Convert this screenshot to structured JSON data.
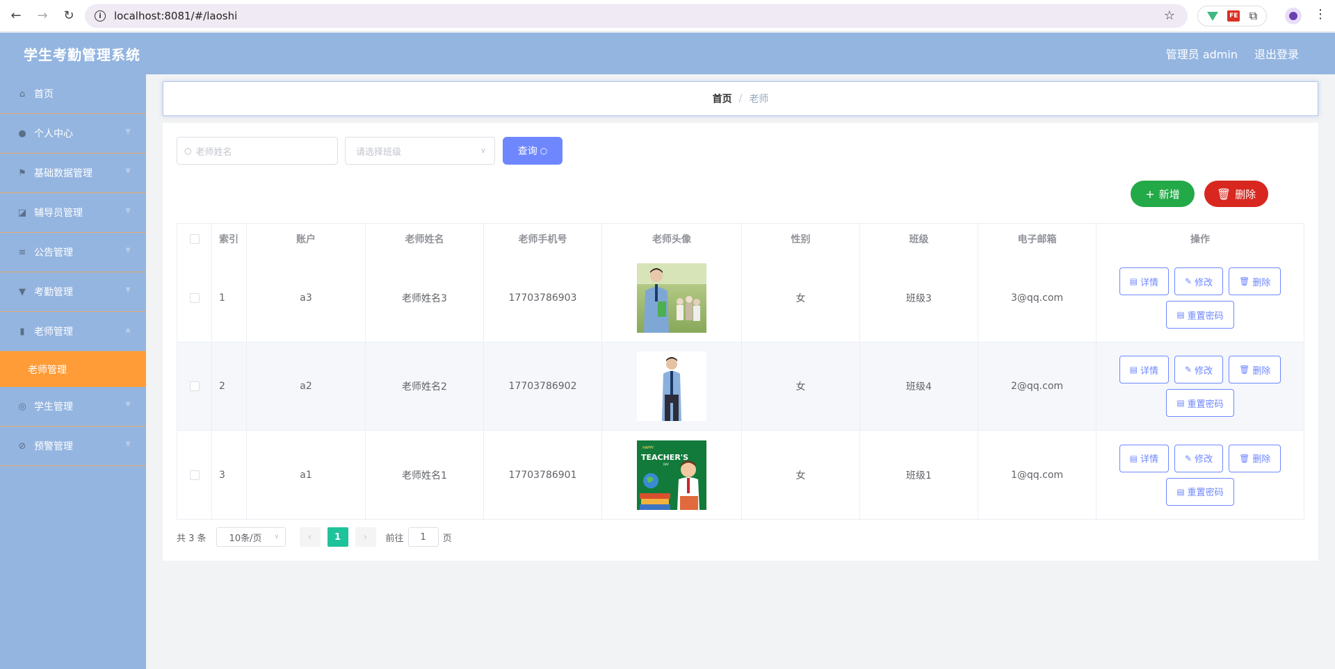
{
  "browser": {
    "url": "localhost:8081/#/laoshi",
    "ext_fe_label": "FE"
  },
  "header": {
    "title": "学生考勤管理系统",
    "user_label": "管理员 admin",
    "logout_label": "退出登录"
  },
  "sidebar": {
    "items": [
      {
        "label": "首页",
        "icon": "home-icon"
      },
      {
        "label": "个人中心",
        "icon": "user-icon"
      },
      {
        "label": "基础数据管理",
        "icon": "flag-icon"
      },
      {
        "label": "辅导员管理",
        "icon": "chart-icon"
      },
      {
        "label": "公告管理",
        "icon": "list-icon"
      },
      {
        "label": "考勤管理",
        "icon": "stamp-icon"
      },
      {
        "label": "老师管理",
        "icon": "bar-chart-icon"
      },
      {
        "label": "学生管理",
        "icon": "compass-icon"
      },
      {
        "label": "预警管理",
        "icon": "no-bell-icon"
      }
    ],
    "active_sub": "老师管理"
  },
  "breadcrumb": {
    "home": "首页",
    "separator": "/",
    "current": "老师"
  },
  "search": {
    "name_placeholder": "老师姓名",
    "class_placeholder": "请选择班级",
    "query_label": "查询"
  },
  "actions": {
    "add_label": "新增",
    "delete_label": "删除"
  },
  "table": {
    "headers": [
      "索引",
      "账户",
      "老师姓名",
      "老师手机号",
      "老师头像",
      "性别",
      "班级",
      "电子邮箱",
      "操作"
    ],
    "rows": [
      {
        "index": "1",
        "account": "a3",
        "name": "老师姓名3",
        "phone": "17703786903",
        "gender": "女",
        "class": "班级3",
        "email": "3@qq.com"
      },
      {
        "index": "2",
        "account": "a2",
        "name": "老师姓名2",
        "phone": "17703786902",
        "gender": "女",
        "class": "班级4",
        "email": "2@qq.com"
      },
      {
        "index": "3",
        "account": "a1",
        "name": "老师姓名1",
        "phone": "17703786901",
        "gender": "女",
        "class": "班级1",
        "email": "1@qq.com"
      }
    ],
    "op_labels": {
      "detail": "详情",
      "edit": "修改",
      "delete": "删除",
      "reset": "重置密码"
    }
  },
  "avatar3_text": {
    "happy": "HAPPY",
    "teachers": "TEACHER'S",
    "day": "DAY"
  },
  "pagination": {
    "total": "共 3 条",
    "page_size": "10条/页",
    "current_page": "1",
    "goto_prefix": "前往",
    "goto_value": "1",
    "goto_suffix": "页"
  },
  "colors": {
    "theme_blue": "#94b5e0",
    "accent_orange": "#ff9c38",
    "primary": "#6e87ff",
    "success": "#23a947",
    "danger": "#d7271f",
    "page_active": "#1ec29b"
  }
}
